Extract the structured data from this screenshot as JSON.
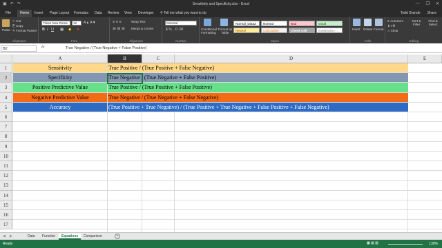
{
  "window": {
    "title": "Sensitivity and Specificity.xlsx - Excel",
    "user": "Todd Grande",
    "share": "Share"
  },
  "ribbon_tabs": [
    "File",
    "Home",
    "Insert",
    "Page Layout",
    "Formulas",
    "Data",
    "Review",
    "View",
    "Developer"
  ],
  "active_tab": "Home",
  "tell_me": "Tell me what you want to do",
  "ribbon": {
    "clipboard": {
      "paste": "Paste",
      "cut": "Cut",
      "copy": "Copy",
      "format_painter": "Format Painter",
      "caption": "Clipboard"
    },
    "font": {
      "name": "Times New Roma",
      "size": "12",
      "caption": "Font"
    },
    "alignment": {
      "wrap": "Wrap Text",
      "merge": "Merge & Center",
      "caption": "Alignment"
    },
    "number": {
      "format": "General",
      "caption": "Number"
    },
    "styles": {
      "conditional": "Conditional Formatting",
      "format_table": "Format as Table",
      "boxes": [
        "Normal_Data2",
        "Normal",
        "Bad",
        "Good",
        "Neutral",
        "Calculation",
        "Check Cell",
        "Explanatory ..."
      ],
      "caption": "Styles"
    },
    "cells": {
      "insert": "Insert",
      "delete": "Delete",
      "format": "Format",
      "caption": "Cells"
    },
    "editing": {
      "autosum": "AutoSum",
      "fill": "Fill",
      "clear": "Clear",
      "sort": "Sort & Filter",
      "find": "Find & Select",
      "caption": "Editing"
    }
  },
  "formula_bar": {
    "name_box": "B2",
    "fx": "fx",
    "formula": "True Negative / (True Negative + False Positive)"
  },
  "columns": [
    "A",
    "B",
    "C",
    "D",
    "E"
  ],
  "selected_column": "B",
  "rows": [
    "1",
    "2",
    "3",
    "4",
    "5",
    "6",
    "7",
    "8",
    "9",
    "10",
    "11",
    "12",
    "13",
    "14",
    "15",
    "16",
    "17"
  ],
  "selected_row": "2",
  "cells": [
    {
      "label": "Sensitivity",
      "formula": "True Positive / (True Positive + False Negative)"
    },
    {
      "label": "Specificity",
      "formula": "True Negative / (True Negative + False Positive)"
    },
    {
      "label": "Positive Predictive Value",
      "formula": "True Positive / (True Positive + False Positive)"
    },
    {
      "label": "Negative Predictive Value",
      "formula": "True Negative / (True Negative + False Negative)"
    },
    {
      "label": "Accuracy",
      "formula": "(True Positive + True Negative) / (True Positive + True Negative + False Positive + False Negative)"
    }
  ],
  "row_colors": [
    "#ffd88a",
    "#8497b0",
    "#66e08a",
    "#f26b15",
    "#2e6bc4"
  ],
  "row_text_colors": [
    "#000000",
    "#000000",
    "#000000",
    "#000000",
    "#ffffff"
  ],
  "sheets": [
    "Data",
    "Function",
    "Equations",
    "Comparison"
  ],
  "active_sheet": "Equations",
  "status": {
    "ready": "Ready",
    "zoom": "130%"
  },
  "colors": {
    "excel_green": "#217346"
  }
}
